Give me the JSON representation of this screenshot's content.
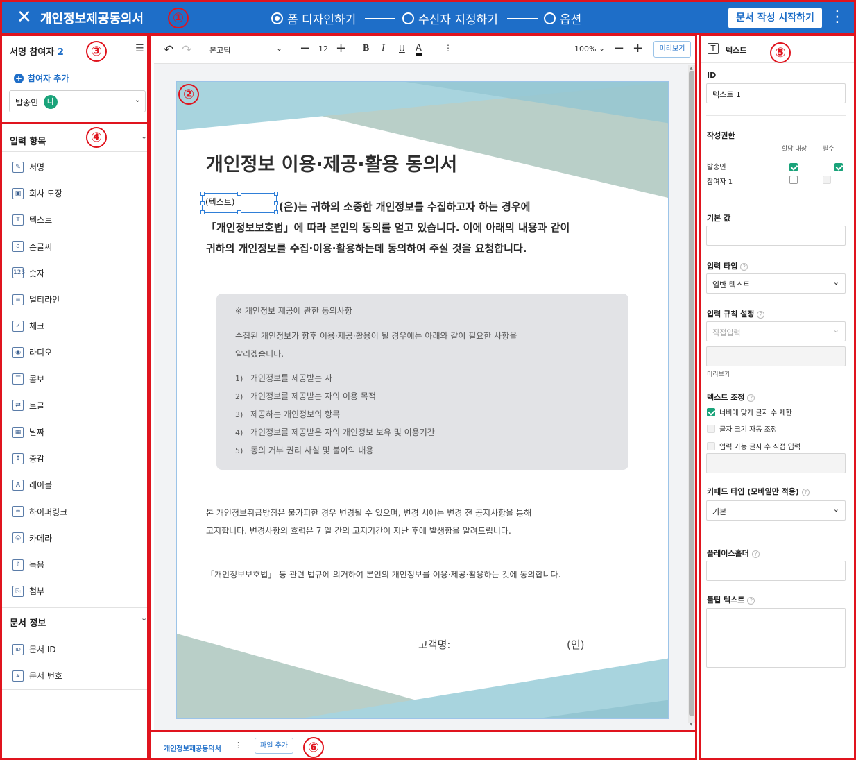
{
  "header": {
    "title": "개인정보제공동의서",
    "steps": [
      "폼 디자인하기",
      "수신자 지정하기",
      "옵션"
    ],
    "start_button": "문서 작성 시작하기"
  },
  "callouts": [
    "①",
    "②",
    "③",
    "④",
    "⑤",
    "⑥"
  ],
  "signers": {
    "title": "서명 참여자",
    "count": "2",
    "add_label": "참여자 추가",
    "select_label": "발송인",
    "badge": "나"
  },
  "input_items": {
    "title": "입력 항목",
    "items": [
      {
        "label": "서명",
        "icon": "signature-icon"
      },
      {
        "label": "회사 도장",
        "icon": "stamp-icon"
      },
      {
        "label": "텍스트",
        "icon": "text-icon"
      },
      {
        "label": "손글씨",
        "icon": "handwriting-icon"
      },
      {
        "label": "숫자",
        "icon": "number-icon"
      },
      {
        "label": "멀티라인",
        "icon": "multiline-icon"
      },
      {
        "label": "체크",
        "icon": "checkbox-icon"
      },
      {
        "label": "라디오",
        "icon": "radio-icon"
      },
      {
        "label": "콤보",
        "icon": "combo-icon"
      },
      {
        "label": "토글",
        "icon": "toggle-icon"
      },
      {
        "label": "날짜",
        "icon": "calendar-icon"
      },
      {
        "label": "증감",
        "icon": "stepper-icon"
      },
      {
        "label": "레이블",
        "icon": "label-icon"
      },
      {
        "label": "하이퍼링크",
        "icon": "link-icon"
      },
      {
        "label": "카메라",
        "icon": "camera-icon"
      },
      {
        "label": "녹음",
        "icon": "microphone-icon"
      },
      {
        "label": "첨부",
        "icon": "attachment-icon"
      }
    ]
  },
  "doc_info": {
    "title": "문서 정보",
    "items": [
      {
        "label": "문서 ID",
        "icon": "doc-id-icon"
      },
      {
        "label": "문서 번호",
        "icon": "doc-number-icon"
      }
    ]
  },
  "toolbar": {
    "font": "본고딕",
    "font_size": "12",
    "bold": "B",
    "italic": "I",
    "underline": "U",
    "color": "A",
    "zoom": "100%",
    "preview": "미리보기"
  },
  "document": {
    "heading": "개인정보 이용·제공·활용 동의서",
    "field_label": "(텍스트)",
    "intro": [
      "(은)는 귀하의 소중한 개인정보를 수집하고자 하는 경우에",
      "「개인정보보호법」에 따라 본인의 동의를 얻고 있습니다. 이에 아래의 내용과 같이",
      "귀하의 개인정보를 수집·이용·활용하는데 동의하여 주실 것을 요청합니다."
    ],
    "box_title": "※ 개인정보 제공에 관한 동의사항",
    "box_text": [
      "수집된 개인정보가 향후 이용·제공·활용이 될 경우에는 아래와 같이 필요한 사항을",
      "알리겠습니다."
    ],
    "box_list": [
      {
        "num": "1)",
        "text": "개인정보를 제공받는 자"
      },
      {
        "num": "2)",
        "text": "개인정보를 제공받는 자의 이용 목적"
      },
      {
        "num": "3)",
        "text": "제공하는 개인정보의 항목"
      },
      {
        "num": "4)",
        "text": "개인정보를 제공받은 자의 개인정보 보유 및 이용기간"
      },
      {
        "num": "5)",
        "text": "동의 거부 권리 사실 및 불이익 내용"
      }
    ],
    "notice": [
      "본 개인정보취급방침은 불가피한 경우 변경될 수 있으며, 변경 시에는 변경 전 공지사항을 통해",
      "고지합니다. 변경사항의 효력은 7 일 간의 고지기간이 지난 후에 발생함을 알려드립니다."
    ],
    "consent": "「개인정보보호법」 등 관련 법규에 의거하여 본인의 개인정보를 이용·제공·활용하는 것에 동의합니다.",
    "customer_label": "고객명:",
    "seal": "(인)"
  },
  "props": {
    "type_label": "텍스트",
    "id_label": "ID",
    "id_value": "텍스트 1",
    "permission_label": "작성권한",
    "col_target": "할당 대상",
    "col_required": "필수",
    "row1": "발송인",
    "row2": "참여자 1",
    "default_label": "기본 값",
    "input_type_label": "입력 타입",
    "input_type_value": "일반 텍스트",
    "rule_label": "입력 규칙 설정",
    "rule_value": "직접입력",
    "preview_label": "미리보기 |",
    "adjust_label": "텍스트 조정",
    "opt1": "너비에 맞게 글자 수 제한",
    "opt2": "글자 크기 자동 조정",
    "opt3": "입력 가능 글자 수 직접 입력",
    "keypad_label": "키패드 타입 (모바일만 적용)",
    "keypad_value": "기본",
    "placeholder_label": "플레이스홀더",
    "tooltip_label": "툴팁 텍스트"
  },
  "bottom": {
    "tab": "개인정보제공동의서",
    "add_file": "파일 추가"
  },
  "colors": {
    "header_bg": "#1e6ec8",
    "callout_red": "#e0141e",
    "check_green": "#1aa37a"
  }
}
